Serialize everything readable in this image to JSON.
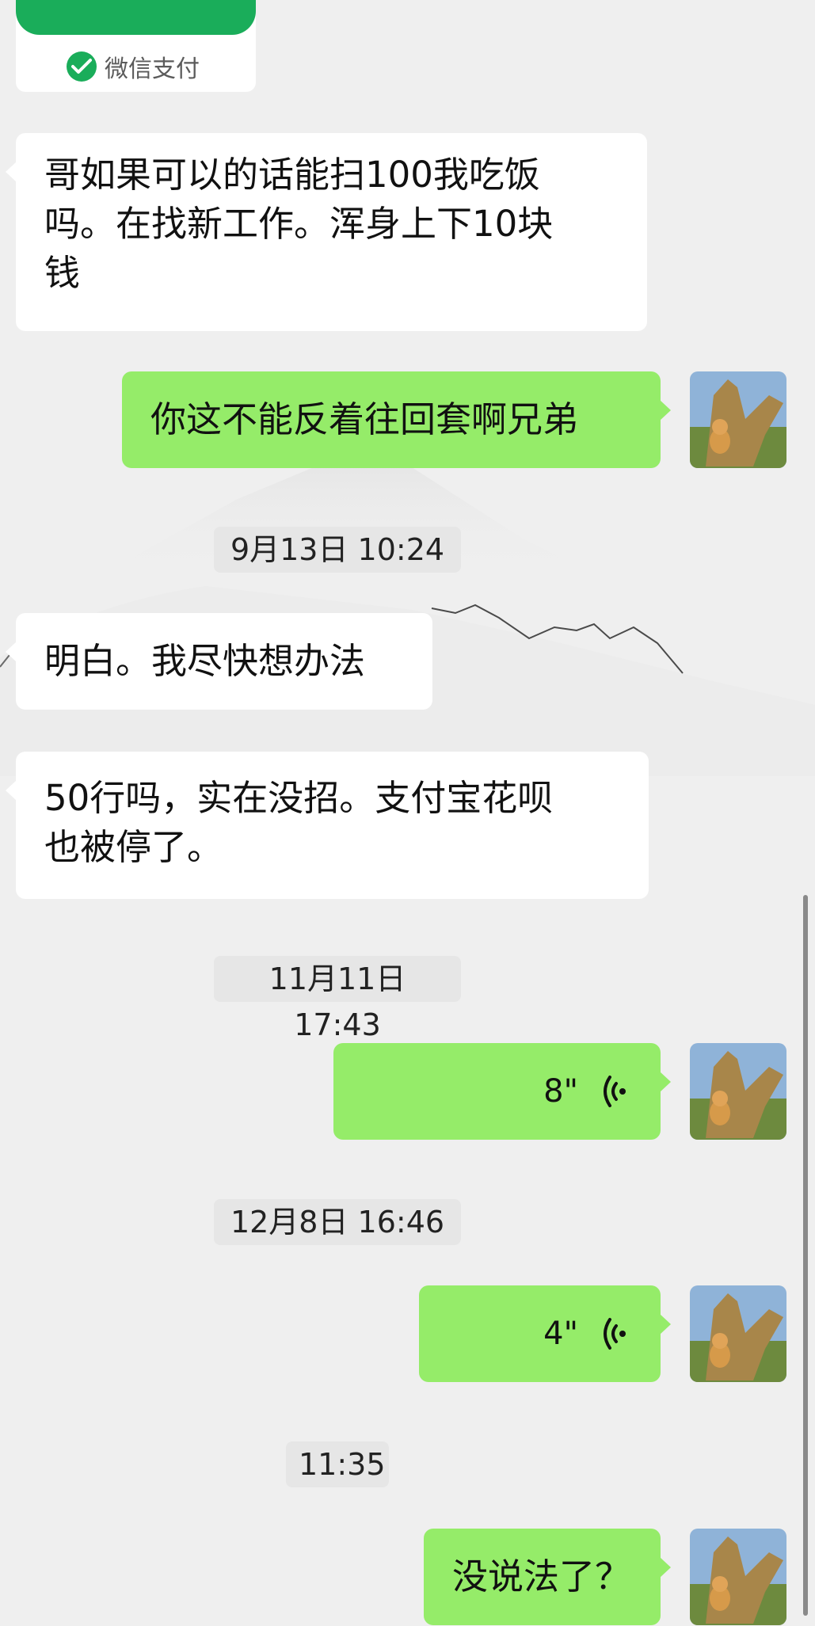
{
  "wechat_pay": {
    "label": "微信支付",
    "icon": "wechat-pay-icon",
    "brand_color": "#1aad5a"
  },
  "colors": {
    "outgoing_bubble": "#95ec69",
    "incoming_bubble": "#ffffff",
    "background": "#efefef"
  },
  "messages": [
    {
      "type": "text",
      "direction": "in",
      "lines": [
        "哥如果可以的话能扫100我吃饭",
        "吗。在找新工作。浑身上下10块",
        "钱"
      ]
    },
    {
      "type": "text",
      "direction": "out",
      "lines": [
        "你这不能反着往回套啊兄弟"
      ]
    },
    {
      "type": "time",
      "text": "9月13日 10:24"
    },
    {
      "type": "text",
      "direction": "in",
      "lines": [
        "明白。我尽快想办法"
      ]
    },
    {
      "type": "text",
      "direction": "in",
      "lines": [
        "50行吗，实在没招。支付宝花呗",
        "也被停了。"
      ]
    },
    {
      "type": "time",
      "text": "11月11日 17:43"
    },
    {
      "type": "voice",
      "direction": "out",
      "duration": "8\""
    },
    {
      "type": "time",
      "text": "12月8日 16:46"
    },
    {
      "type": "voice",
      "direction": "out",
      "duration": "4\""
    },
    {
      "type": "time",
      "text": "11:35"
    },
    {
      "type": "text",
      "direction": "out",
      "lines": [
        "没说法了？"
      ]
    }
  ]
}
